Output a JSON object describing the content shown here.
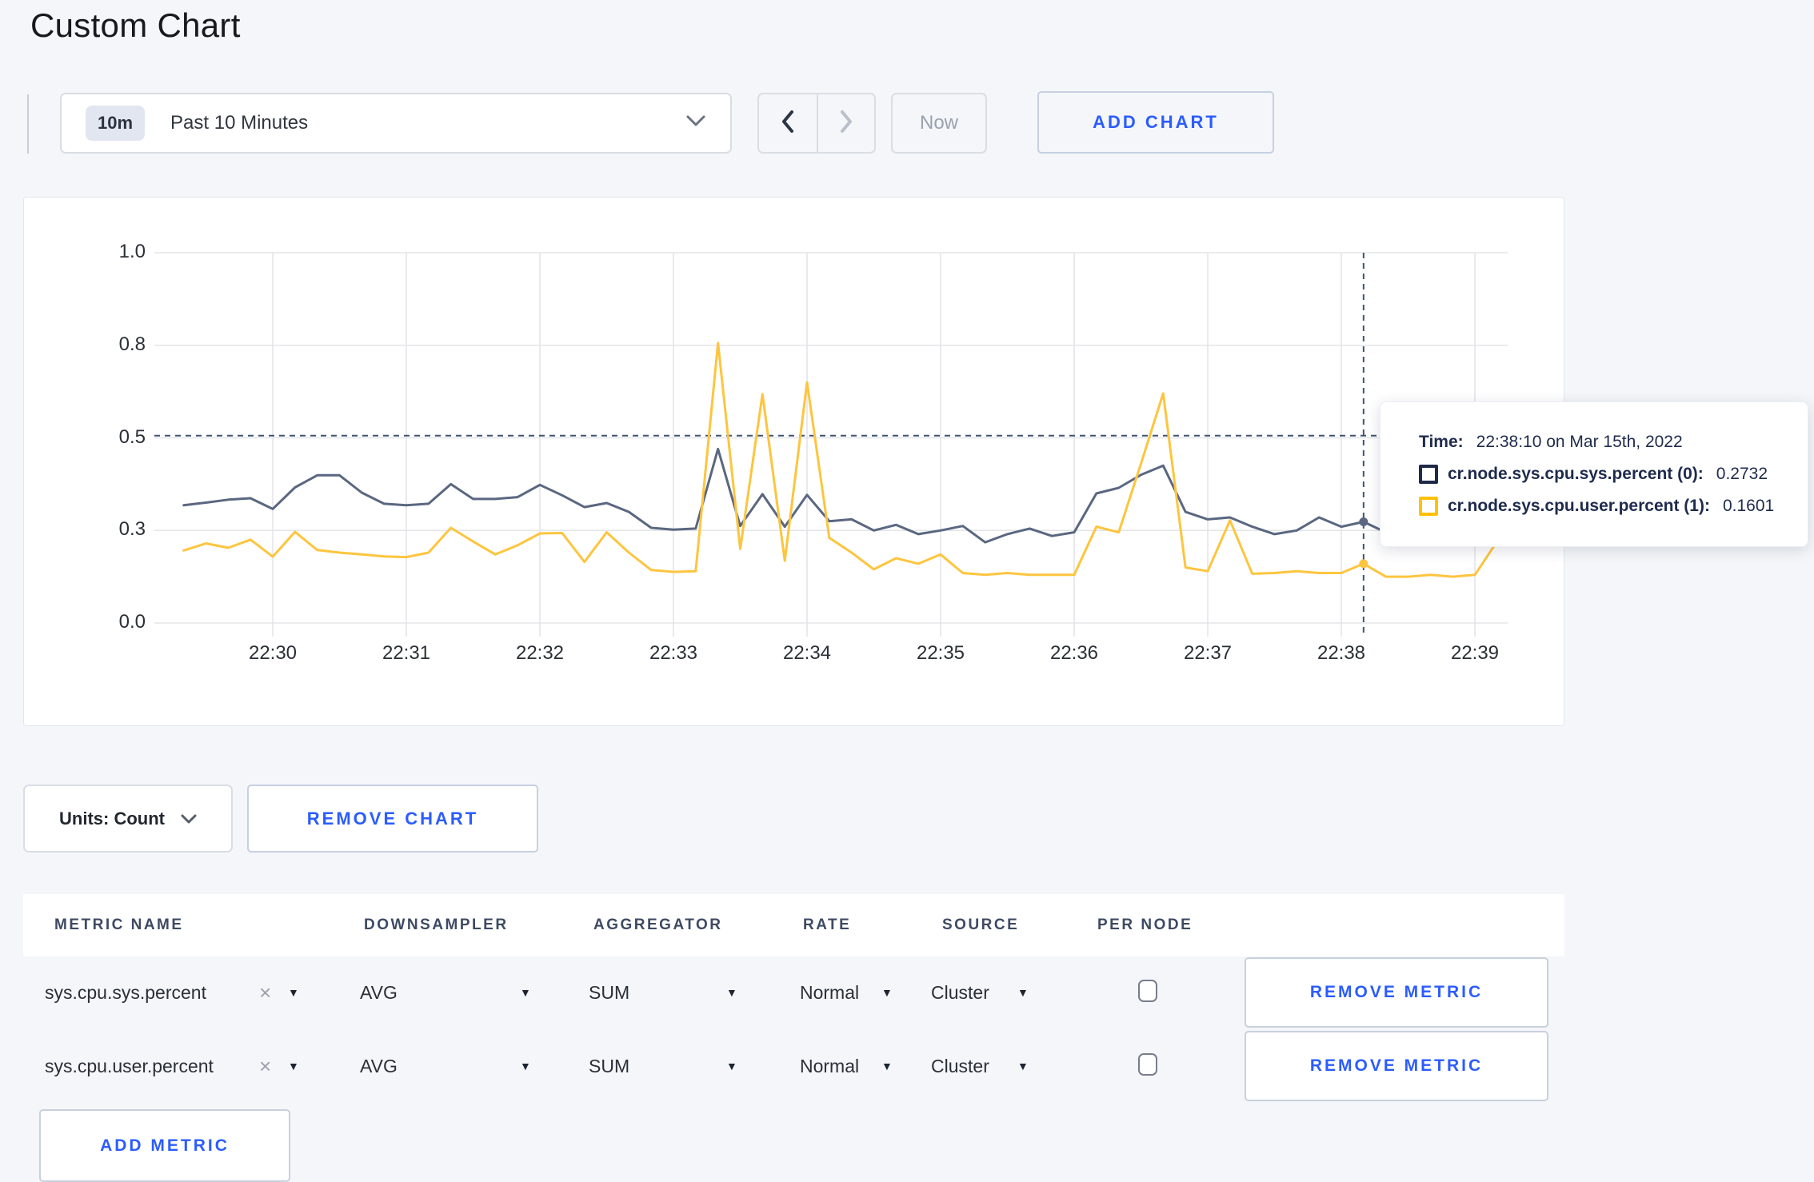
{
  "page": {
    "title": "Custom Chart",
    "background": "#f4f6f9",
    "accent_blue": "#2b5cfe"
  },
  "toolbar": {
    "time_selector": {
      "badge": "10m",
      "label": "Past 10 Minutes"
    },
    "now_label": "Now",
    "add_chart_label": "ADD CHART"
  },
  "chart_data": {
    "type": "line",
    "title": "",
    "xlabel": "",
    "ylabel": "",
    "grid": true,
    "legend_position": "tooltip",
    "x_tick_labels": [
      "22:30",
      "22:31",
      "22:32",
      "22:33",
      "22:34",
      "22:35",
      "22:36",
      "22:37",
      "22:38",
      "22:39"
    ],
    "y_axis": {
      "labels": [
        "0.0",
        "0.3",
        "0.5",
        "0.8",
        "1.0"
      ],
      "values": [
        0,
        0.25,
        0.5,
        0.75,
        1.0
      ],
      "ylim": [
        0,
        1
      ]
    },
    "start_time": "22:29:20",
    "step_seconds": 10,
    "series": [
      {
        "name": "cr.node.sys.cpu.sys.percent (0)",
        "color": "#5a6780",
        "values": [
          0.318,
          0.325,
          0.333,
          0.337,
          0.308,
          0.366,
          0.399,
          0.399,
          0.352,
          0.322,
          0.318,
          0.322,
          0.375,
          0.335,
          0.335,
          0.34,
          0.373,
          0.345,
          0.313,
          0.324,
          0.3,
          0.257,
          0.252,
          0.255,
          0.47,
          0.262,
          0.348,
          0.26,
          0.346,
          0.275,
          0.28,
          0.25,
          0.265,
          0.24,
          0.25,
          0.262,
          0.218,
          0.24,
          0.255,
          0.235,
          0.245,
          0.35,
          0.365,
          0.4,
          0.425,
          0.3,
          0.28,
          0.285,
          0.26,
          0.24,
          0.25,
          0.285,
          0.26,
          0.2732,
          0.245,
          0.25,
          0.26,
          0.27,
          0.28,
          0.3
        ]
      },
      {
        "name": "cr.node.sys.cpu.user.percent (1)",
        "color": "#fdc53f",
        "values": [
          0.196,
          0.215,
          0.203,
          0.225,
          0.179,
          0.246,
          0.197,
          0.19,
          0.185,
          0.18,
          0.178,
          0.19,
          0.257,
          0.22,
          0.185,
          0.21,
          0.242,
          0.243,
          0.165,
          0.245,
          0.19,
          0.143,
          0.138,
          0.14,
          0.756,
          0.2,
          0.618,
          0.168,
          0.65,
          0.23,
          0.19,
          0.145,
          0.175,
          0.16,
          0.185,
          0.135,
          0.13,
          0.135,
          0.13,
          0.13,
          0.13,
          0.26,
          0.245,
          0.43,
          0.62,
          0.15,
          0.14,
          0.277,
          0.133,
          0.135,
          0.14,
          0.135,
          0.135,
          0.1601,
          0.125,
          0.125,
          0.13,
          0.125,
          0.13,
          0.22
        ]
      }
    ],
    "crosshair": {
      "time": "22:38:10",
      "point_index": 53,
      "hline_value": 0.506,
      "color": "#3f5470"
    }
  },
  "tooltip": {
    "time_label": "Time:",
    "time_value": "22:38:10 on Mar 15th, 2022",
    "rows": [
      {
        "label": "cr.node.sys.cpu.sys.percent (0):",
        "value": "0.2732",
        "swatch_color": "#1f2a48"
      },
      {
        "label": "cr.node.sys.cpu.user.percent (1):",
        "value": "0.1601",
        "swatch_color": "#ffc107"
      }
    ]
  },
  "chart_footer": {
    "units_label": "Units: Count",
    "remove_chart_label": "REMOVE CHART"
  },
  "metrics_table": {
    "headers": [
      "METRIC NAME",
      "DOWNSAMPLER",
      "AGGREGATOR",
      "RATE",
      "SOURCE",
      "PER NODE"
    ],
    "remove_icon": "×",
    "caret_icon": "▼",
    "rows": [
      {
        "metric": "sys.cpu.sys.percent",
        "downsampler": "AVG",
        "aggregator": "SUM",
        "rate": "Normal",
        "source": "Cluster",
        "per_node_checked": false
      },
      {
        "metric": "sys.cpu.user.percent",
        "downsampler": "AVG",
        "aggregator": "SUM",
        "rate": "Normal",
        "source": "Cluster",
        "per_node_checked": false
      }
    ],
    "remove_metric_label": "REMOVE METRIC",
    "add_metric_label": "ADD METRIC"
  }
}
